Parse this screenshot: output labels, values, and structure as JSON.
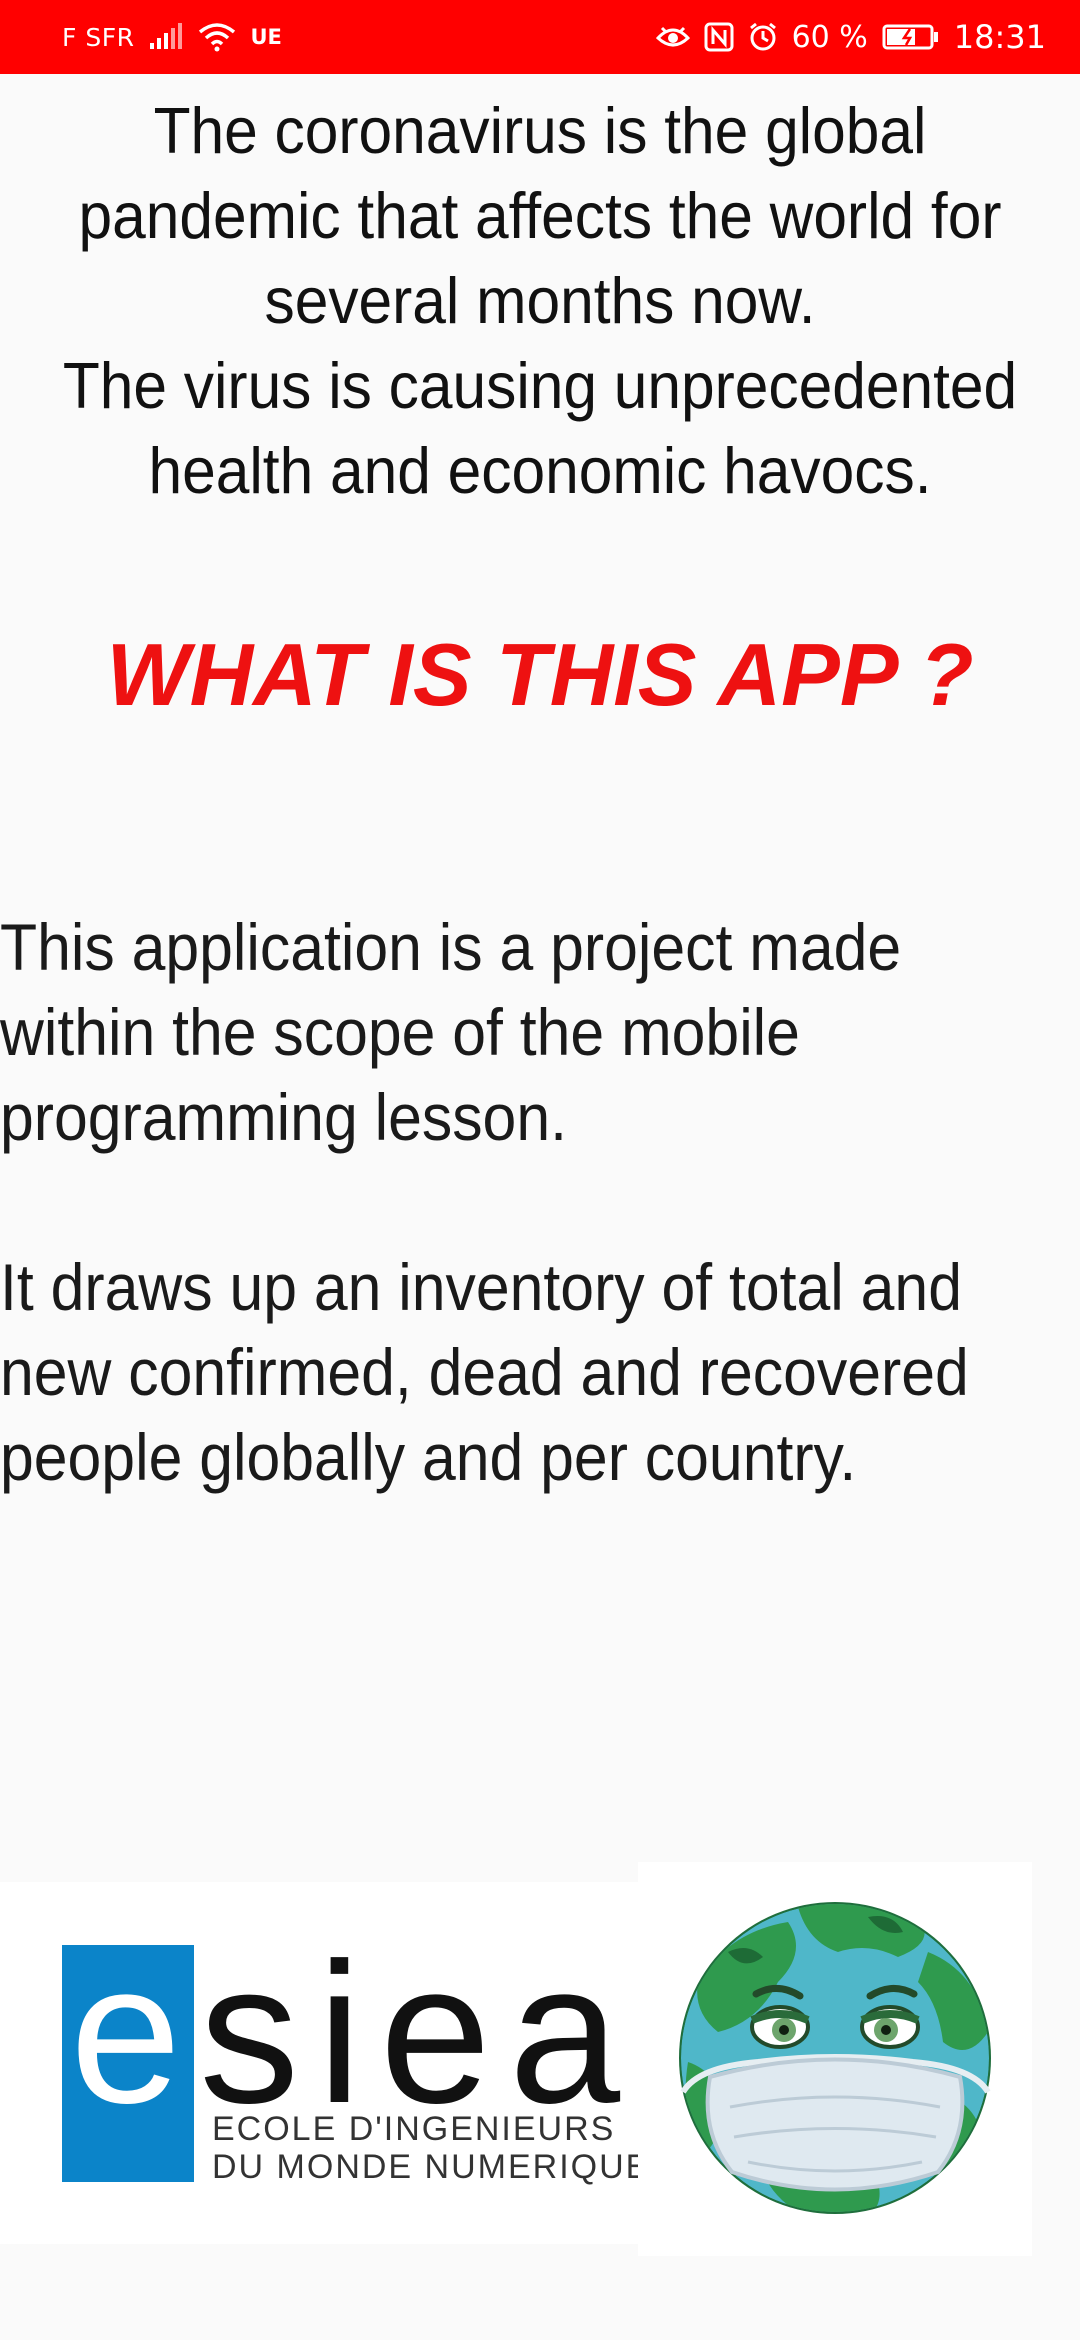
{
  "status_bar": {
    "carrier": "F SFR",
    "network": "UE",
    "battery_percent": "60 %",
    "time": "18:31",
    "icons": [
      "signal-icon",
      "wifi-icon",
      "eye-icon",
      "nfc-icon",
      "alarm-icon",
      "battery-icon"
    ],
    "background_color": "#ff0000"
  },
  "intro": {
    "lines": [
      "The coronavirus is the global",
      "pandemic that affects the world for",
      "several months now.",
      " The virus is causing unprecedented",
      "health and economic havocs."
    ]
  },
  "heading": {
    "text": "WHAT IS THIS APP ?",
    "color": "#ee1111"
  },
  "description": {
    "paragraph_1": [
      "This application is a project made",
      "within the scope of the mobile",
      "programming lesson."
    ],
    "paragraph_2": [
      "It draws up an inventory of total and",
      "new confirmed, dead and recovered",
      "people globally and per country."
    ]
  },
  "logos": {
    "esiea": {
      "wordmark": "esiea",
      "subtitle_line_1": "ECOLE D'INGENIEURS",
      "subtitle_line_2": "DU MONDE NUMERIQUE",
      "brand_color": "#0b84c9"
    },
    "globe": {
      "icon": "masked-earth-icon"
    }
  }
}
